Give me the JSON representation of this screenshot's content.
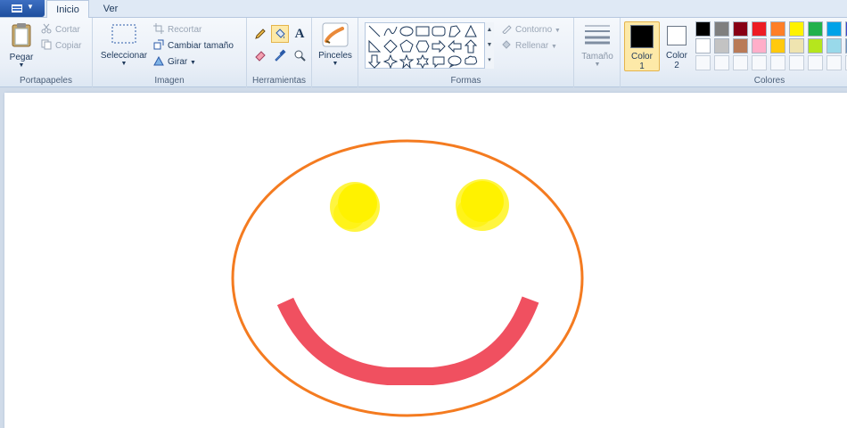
{
  "tabs": [
    {
      "label": "Inicio"
    },
    {
      "label": "Ver"
    }
  ],
  "clipboard": {
    "paste": "Pegar",
    "cut": "Cortar",
    "copy": "Copiar",
    "label": "Portapapeles"
  },
  "image": {
    "select": "Seleccionar",
    "crop": "Recortar",
    "resize": "Cambiar tamaño",
    "rotate": "Girar",
    "label": "Imagen"
  },
  "tools": {
    "label": "Herramientas",
    "text_glyph": "A"
  },
  "brushes": {
    "label": "Pinceles"
  },
  "shapes": {
    "outline": "Contorno",
    "fill": "Rellenar",
    "label": "Formas"
  },
  "size": {
    "label": "Tamaño"
  },
  "colors": {
    "label": "Colores",
    "color1": {
      "line1": "Color",
      "line2": "1",
      "value": "#000000"
    },
    "color2": {
      "line1": "Color",
      "line2": "2",
      "value": "#ffffff"
    },
    "row1": [
      "#000000",
      "#7f7f7f",
      "#880015",
      "#ed1c24",
      "#ff7f27",
      "#fff200",
      "#22b14c",
      "#00a2e8",
      "#3f48cc"
    ],
    "row2": [
      "#ffffff",
      "#c3c3c3",
      "#b97a57",
      "#ffaec9",
      "#ffc90e",
      "#efe4b0",
      "#b5e61d",
      "#99d9ea",
      "#7092be"
    ]
  },
  "drawing": {
    "face_outline": "#f47b20",
    "eyes": "#fff200",
    "mouth": "#f05060"
  }
}
